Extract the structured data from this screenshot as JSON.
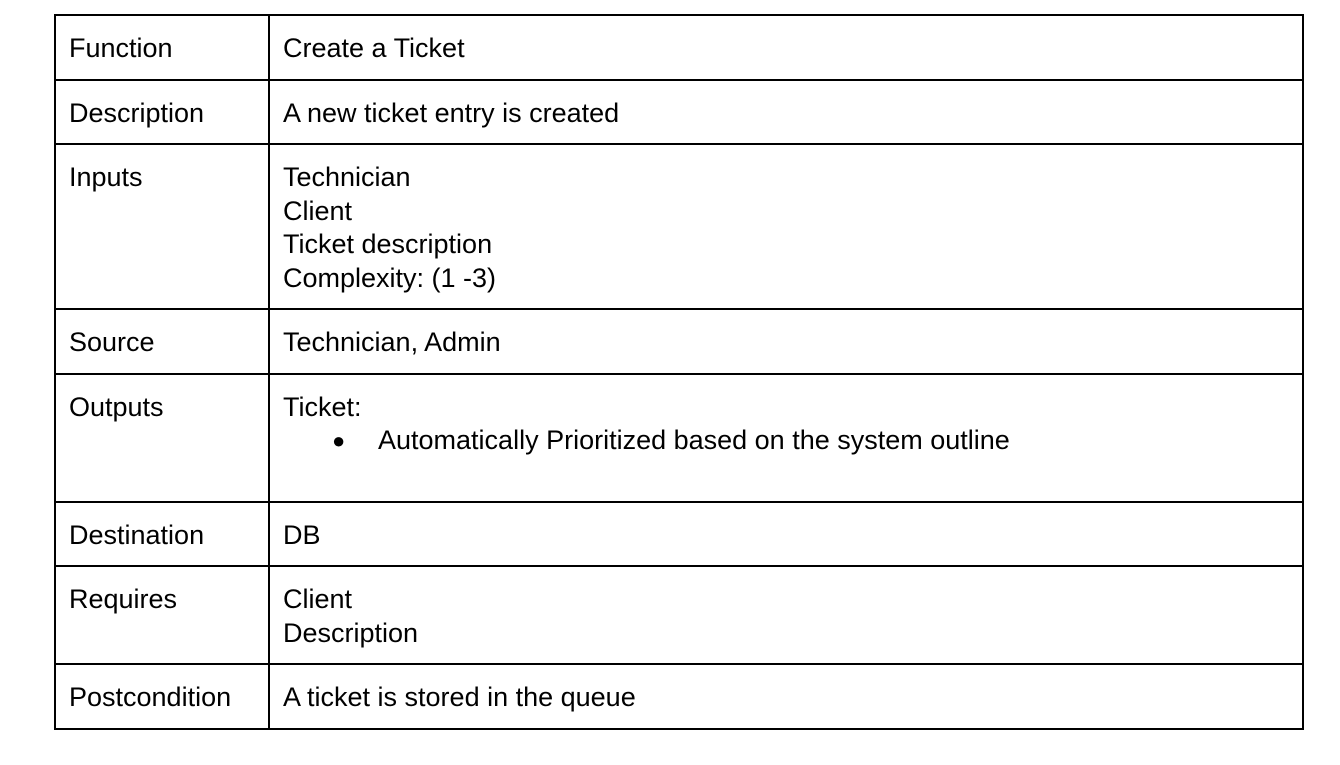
{
  "rows": [
    {
      "label": "Function",
      "lines": [
        "Create a Ticket"
      ]
    },
    {
      "label": "Description",
      "lines": [
        "A new ticket entry is created"
      ]
    },
    {
      "label": "Inputs",
      "lines": [
        "Technician",
        "Client",
        "Ticket description",
        "Complexity: (1 -3)"
      ]
    },
    {
      "label": "Source",
      "lines": [
        "Technician, Admin"
      ]
    },
    {
      "label": "Outputs",
      "lines": [
        "Ticket:"
      ],
      "bullets": [
        "Automatically Prioritized based on the system outline"
      ],
      "bullet_symbol": "●"
    },
    {
      "label": "Destination",
      "lines": [
        "DB"
      ]
    },
    {
      "label": "Requires",
      "lines": [
        "Client",
        "Description"
      ]
    },
    {
      "label": "Postcondition",
      "lines": [
        "A ticket is stored in the queue"
      ]
    }
  ]
}
